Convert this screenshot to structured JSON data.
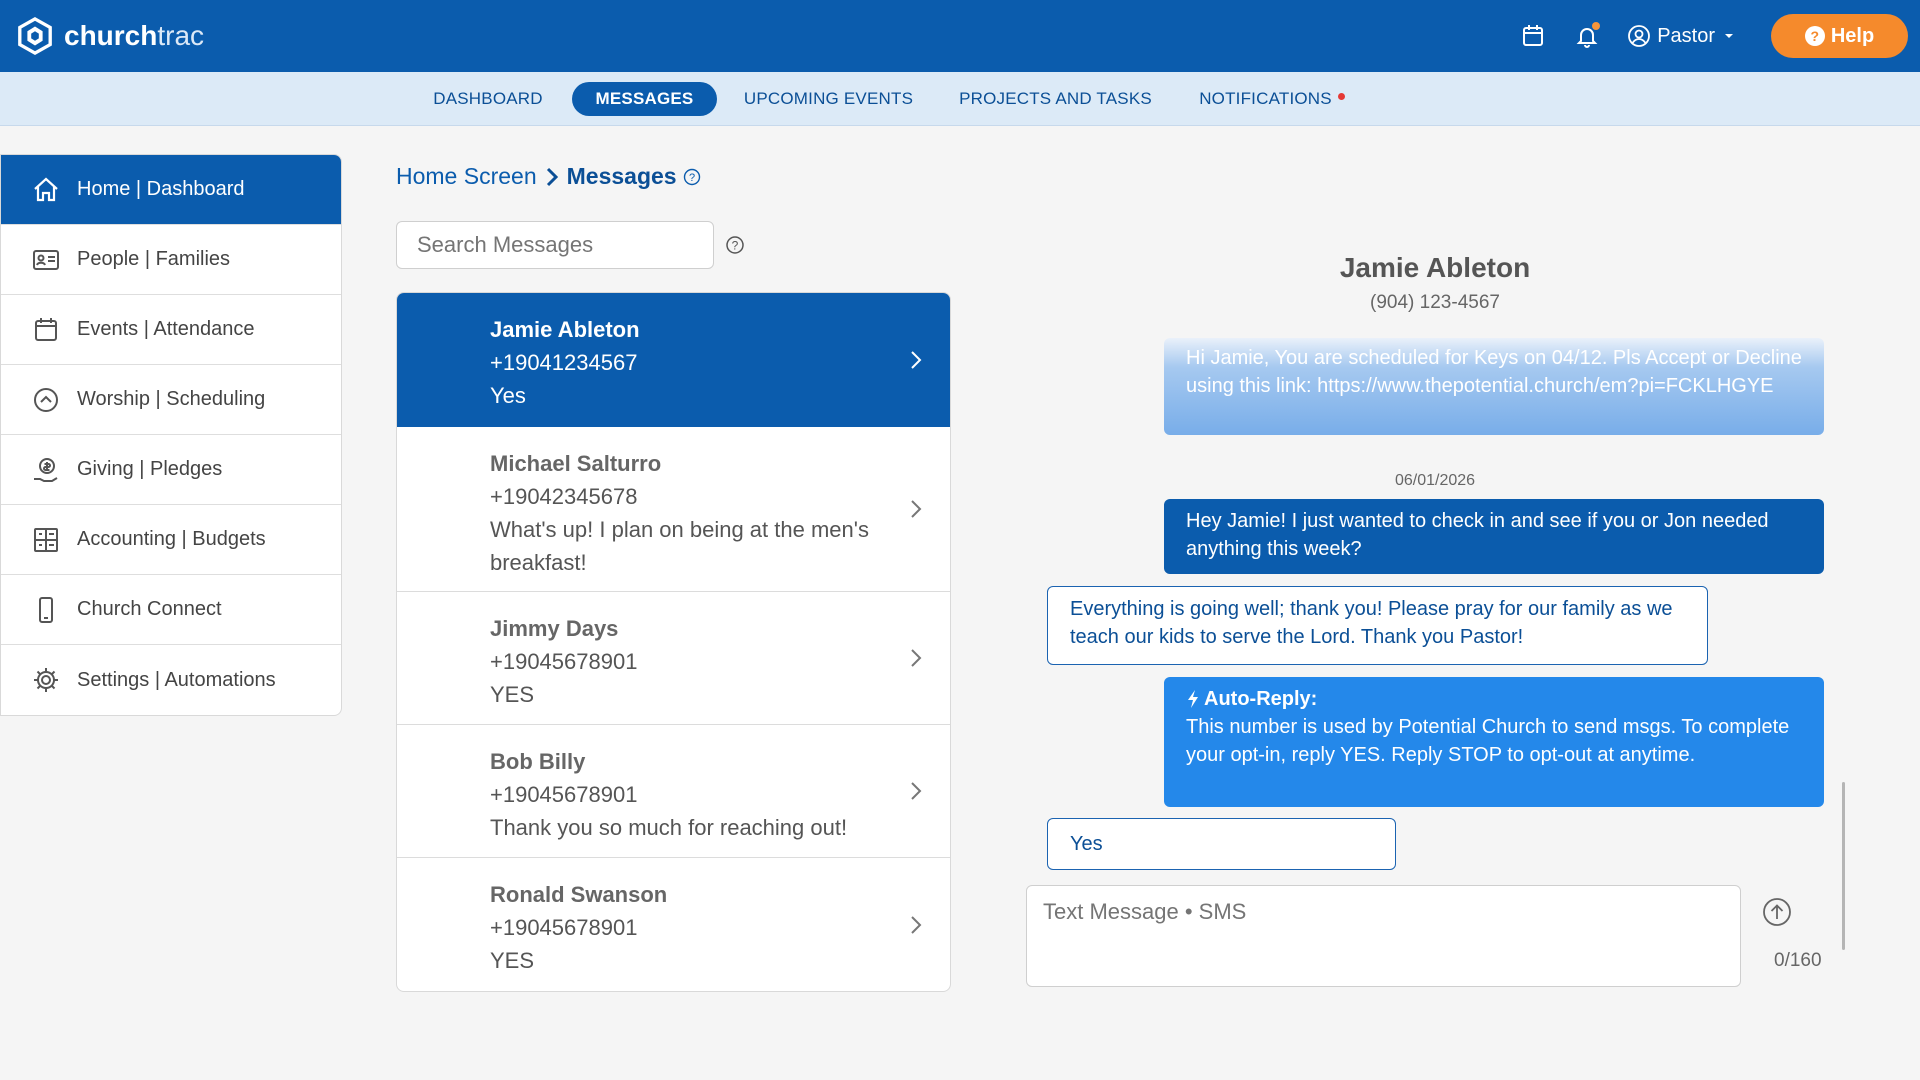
{
  "app": {
    "logo_word1": "church",
    "logo_word2": "trac",
    "user_label": "Pastor",
    "help_label": "Help",
    "brand_color": "#0b5cad",
    "accent_color": "#f58a2c"
  },
  "tabs": [
    {
      "label": "DASHBOARD",
      "active": false
    },
    {
      "label": "MESSAGES",
      "active": true
    },
    {
      "label": "UPCOMING EVENTS",
      "active": false
    },
    {
      "label": "PROJECTS AND TASKS",
      "active": false
    },
    {
      "label": "NOTIFICATIONS",
      "active": false,
      "indicator": "red-dot"
    }
  ],
  "sidebar": {
    "items": [
      {
        "label": "Home | Dashboard",
        "icon": "home-icon",
        "active": true
      },
      {
        "label": "People | Families",
        "icon": "id-card-icon"
      },
      {
        "label": "Events | Attendance",
        "icon": "calendar-icon"
      },
      {
        "label": "Worship | Scheduling",
        "icon": "chevron-up-circle-icon"
      },
      {
        "label": "Giving | Pledges",
        "icon": "money-hand-icon"
      },
      {
        "label": "Accounting | Budgets",
        "icon": "ledger-grid-icon"
      },
      {
        "label": "Church Connect",
        "icon": "phone-icon"
      },
      {
        "label": "Settings | Automations",
        "icon": "gear-icon"
      }
    ]
  },
  "breadcrumb": {
    "parent": "Home Screen",
    "current": "Messages"
  },
  "search": {
    "placeholder": "Search Messages"
  },
  "conversations": [
    {
      "name": "Jamie Ableton",
      "phone": "+19041234567",
      "preview": "Yes",
      "active": true
    },
    {
      "name": "Michael Salturro",
      "phone": "+19042345678",
      "preview": "What's up! I plan on being at the men's breakfast!"
    },
    {
      "name": "Jimmy Days",
      "phone": "+19045678901",
      "preview": "YES"
    },
    {
      "name": "Bob Billy",
      "phone": "+19045678901",
      "preview": "Thank you so much for reaching out!"
    },
    {
      "name": "Ronald Swanson",
      "phone": "+19045678901",
      "preview": "YES"
    }
  ],
  "thread": {
    "name": "Jamie Ableton",
    "phone": "(904) 123-4567",
    "date": "06/01/2026",
    "messages": {
      "scheduled": "Hi Jamie, You are scheduled for Keys on 04/12. Pls Accept or Decline using this link: https://www.thepotential.church/em?pi=FCKLHGYE",
      "checkin": "Hey Jamie! I just wanted to check in and see if you or Jon needed anything this week?",
      "reply": "Everything is going well; thank you! Please pray for our family as we teach our kids to serve the Lord. Thank you Pastor!",
      "auto_title": "Auto-Reply:",
      "auto_body": "This number is used by Potential Church to send msgs. To complete your opt-in, reply YES. Reply STOP to opt-out at anytime.",
      "yes": "Yes"
    }
  },
  "composer": {
    "placeholder": "Text Message • SMS",
    "counter": "0/160"
  }
}
